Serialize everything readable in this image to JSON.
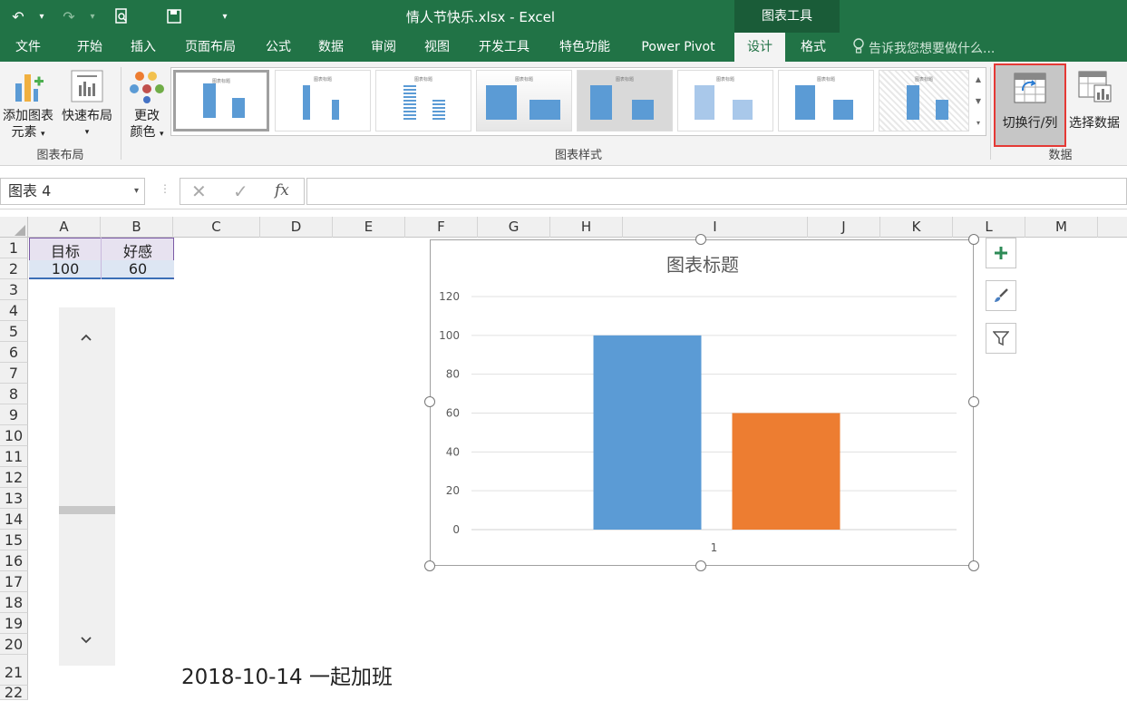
{
  "window": {
    "title": "情人节快乐.xlsx - Excel",
    "context_tab": "图表工具"
  },
  "tabs": [
    "文件",
    "开始",
    "插入",
    "页面布局",
    "公式",
    "数据",
    "审阅",
    "视图",
    "开发工具",
    "特色功能",
    "Power Pivot",
    "设计",
    "格式"
  ],
  "tell_me": "告诉我您想要做什么...",
  "ribbon": {
    "add_element": {
      "line1": "添加图表",
      "line2": "元素"
    },
    "quick_layout": "快速布局",
    "change_color": {
      "line1": "更改",
      "line2": "颜色"
    },
    "group_layout": "图表布局",
    "group_styles": "图表样式",
    "switch_row_col": "切换行/列",
    "select_data": "选择数据",
    "group_data": "数据"
  },
  "formula_bar": {
    "name_box": "图表 4",
    "fx": "fx"
  },
  "columns": [
    "A",
    "B",
    "C",
    "D",
    "E",
    "F",
    "G",
    "H",
    "I",
    "J",
    "K",
    "L",
    "M"
  ],
  "rows": [
    "1",
    "2",
    "3",
    "4",
    "5",
    "6",
    "7",
    "8",
    "9",
    "10",
    "11",
    "12",
    "13",
    "14",
    "15",
    "16",
    "17",
    "18",
    "19",
    "20",
    "21",
    "22"
  ],
  "cells": {
    "a1": "目标",
    "b1": "好感",
    "a2": "100",
    "b2": "60"
  },
  "note": "2018-10-14 一起加班",
  "chart_data": {
    "type": "bar",
    "title": "图表标题",
    "categories": [
      "1"
    ],
    "series": [
      {
        "values": [
          100
        ],
        "color": "#5b9bd5"
      },
      {
        "values": [
          60
        ],
        "color": "#ed7d31"
      }
    ],
    "yticks": [
      "0",
      "20",
      "40",
      "60",
      "80",
      "100",
      "120"
    ],
    "ylim": [
      0,
      120
    ],
    "grid": true
  },
  "colors": {
    "brand": "#217346",
    "highlight": "#e53935"
  }
}
